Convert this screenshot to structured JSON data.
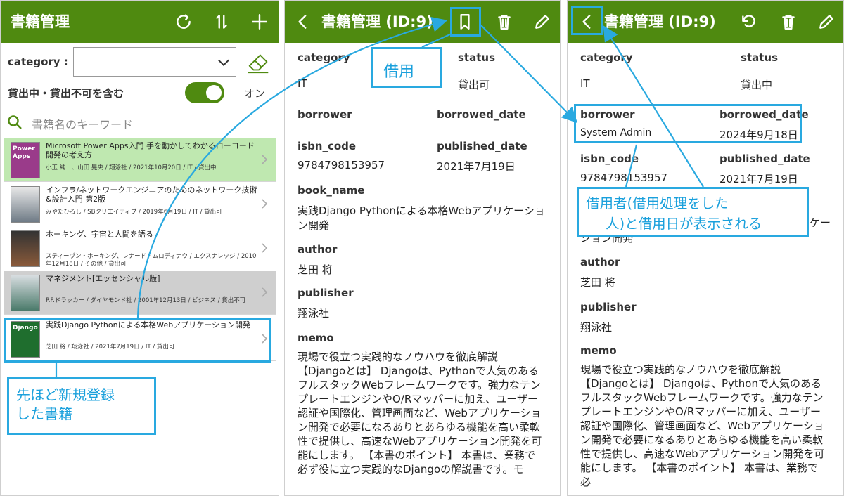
{
  "colors": {
    "header_green": "#4f8a10",
    "accent_blue": "#29a9e0",
    "highlight_row": "#bfe8b0",
    "unavailable_row": "#cfcfcf"
  },
  "list_screen": {
    "title": "書籍管理",
    "icons": [
      "refresh-icon",
      "sort-icon",
      "add-icon"
    ],
    "category_label": "category :",
    "category_value": "",
    "toggle_label": "貸出中・貸出不可を含む",
    "toggle_state": "オン",
    "search_placeholder": "書籍名のキーワード",
    "books": [
      {
        "cover": "Power Apps",
        "title": "Microsoft Power Apps入門 手を動かしてわかるローコード開発の考え方",
        "meta": "小玉 純一、山田 晃央 / 翔泳社 / 2021年10月20日 / IT / 貸出中",
        "state": "highlight"
      },
      {
        "cover": "",
        "title": "インフラ/ネットワークエンジニアのためのネットワーク技術&設計入門 第2版",
        "meta": "みやたひろし / SBクリエイティブ / 2019年6月19日 / IT / 貸出可",
        "state": "normal"
      },
      {
        "cover": "",
        "title": "ホーキング、宇宙と人間を語る",
        "meta": "スティーヴン・ホーキング、レナード・ムロディナウ / エクスナレッジ / 2010年12月18日 / その他 / 貸出可",
        "state": "normal"
      },
      {
        "cover": "",
        "title": "マネジメント[エッセンシャル版]",
        "meta": "P.F.ドラッカー / ダイヤモンド社 / 2001年12月13日 / ビジネス / 貸出不可",
        "state": "unavailable"
      },
      {
        "cover": "Django",
        "title": "実践Django Pythonによる本格Webアプリケーション開発",
        "meta": "芝田 将 / 翔泳社 / 2021年7月19日 / IT / 貸出可",
        "state": "normal"
      }
    ]
  },
  "detail_before": {
    "title": "書籍管理 (ID:9)",
    "fields": {
      "category_label": "category",
      "category_value": "IT",
      "status_label": "status",
      "status_value": "貸出可",
      "borrower_label": "borrower",
      "borrower_value": "",
      "borrowed_date_label": "borrowed_date",
      "borrowed_date_value": "",
      "isbn_label": "isbn_code",
      "isbn_value": "9784798153957",
      "published_label": "published_date",
      "published_value": "2021年7月19日",
      "book_name_label": "book_name",
      "book_name_value": "実践Django Pythonによる本格Webアプリケーション開発",
      "author_label": "author",
      "author_value": "芝田 将",
      "publisher_label": "publisher",
      "publisher_value": "翔泳社",
      "memo_label": "memo",
      "memo_value": "現場で役立つ実践的なノウハウを徹底解説 【Djangoとは】 Djangoは、Pythonで人気のあるフルスタックWebフレームワークです。強力なテンプレートエンジンやO/Rマッパーに加え、ユーザー認証や国際化、管理画面など、Webアプリケーション開発で必要になるありとあらゆる機能を高い柔軟性で提供し、高速なWebアプリケーション開発を可能にします。 【本書のポイント】 本書は、業務で必ず役に立つ実践的なDjangoの解説書です。モ"
    }
  },
  "detail_after": {
    "title": "書籍管理 (ID:9)",
    "fields": {
      "category_label": "category",
      "category_value": "IT",
      "status_label": "status",
      "status_value": "貸出中",
      "borrower_label": "borrower",
      "borrower_value": "System Admin",
      "borrowed_date_label": "borrowed_date",
      "borrowed_date_value": "2024年9月18日",
      "isbn_label": "isbn_code",
      "isbn_value": "9784798153957",
      "published_label": "published_date",
      "published_value": "2021年7月19日",
      "book_name_value_tail": "ケー",
      "book_name_value_line2": "ション開発",
      "author_label": "author",
      "author_value": "芝田 将",
      "publisher_label": "publisher",
      "publisher_value": "翔泳社",
      "memo_label": "memo",
      "memo_value": "現場で役立つ実践的なノウハウを徹底解説 【Djangoとは】 Djangoは、Pythonで人気のあるフルスタックWebフレームワークです。強力なテンプレートエンジンやO/Rマッパーに加え、ユーザー認証や国際化、管理画面など、Webアプリケーション開発で必要になるありとあらゆる機能を高い柔軟性で提供し、高速なWebアプリケーション開発を可能にします。 【本書のポイント】 本書は、業務で必"
    }
  },
  "annotations": {
    "new_book": "先ほど新規登録した書籍",
    "new_book_line1": "先ほど新規登録",
    "new_book_line2": "した書籍",
    "borrow": "借用",
    "borrower_info_line1": "借用者(借用処理をした",
    "borrower_info_line2": "人)と借用日が表示される"
  }
}
